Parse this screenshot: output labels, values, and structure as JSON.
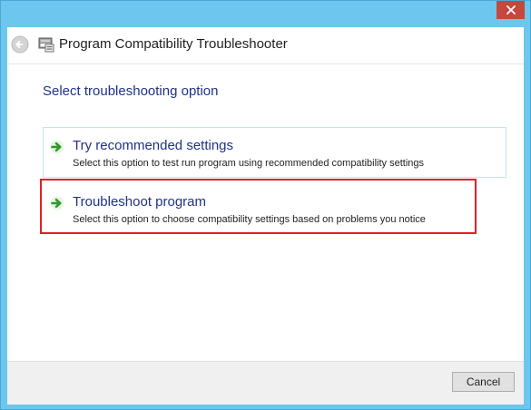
{
  "window": {
    "title": "Program Compatibility Troubleshooter",
    "frame_color": "#6cc6ee",
    "close_color": "#c7463f"
  },
  "page": {
    "heading": "Select troubleshooting option"
  },
  "options": [
    {
      "title": "Try recommended settings",
      "description": "Select this option to test run program using recommended compatibility settings",
      "icon": "green-arrow-icon"
    },
    {
      "title": "Troubleshoot program",
      "description": "Select this option to choose compatibility settings based on problems you notice",
      "icon": "green-arrow-icon"
    }
  ],
  "highlight": {
    "color": "#e02027",
    "target": "Troubleshoot program"
  },
  "footer": {
    "cancel_label": "Cancel"
  }
}
